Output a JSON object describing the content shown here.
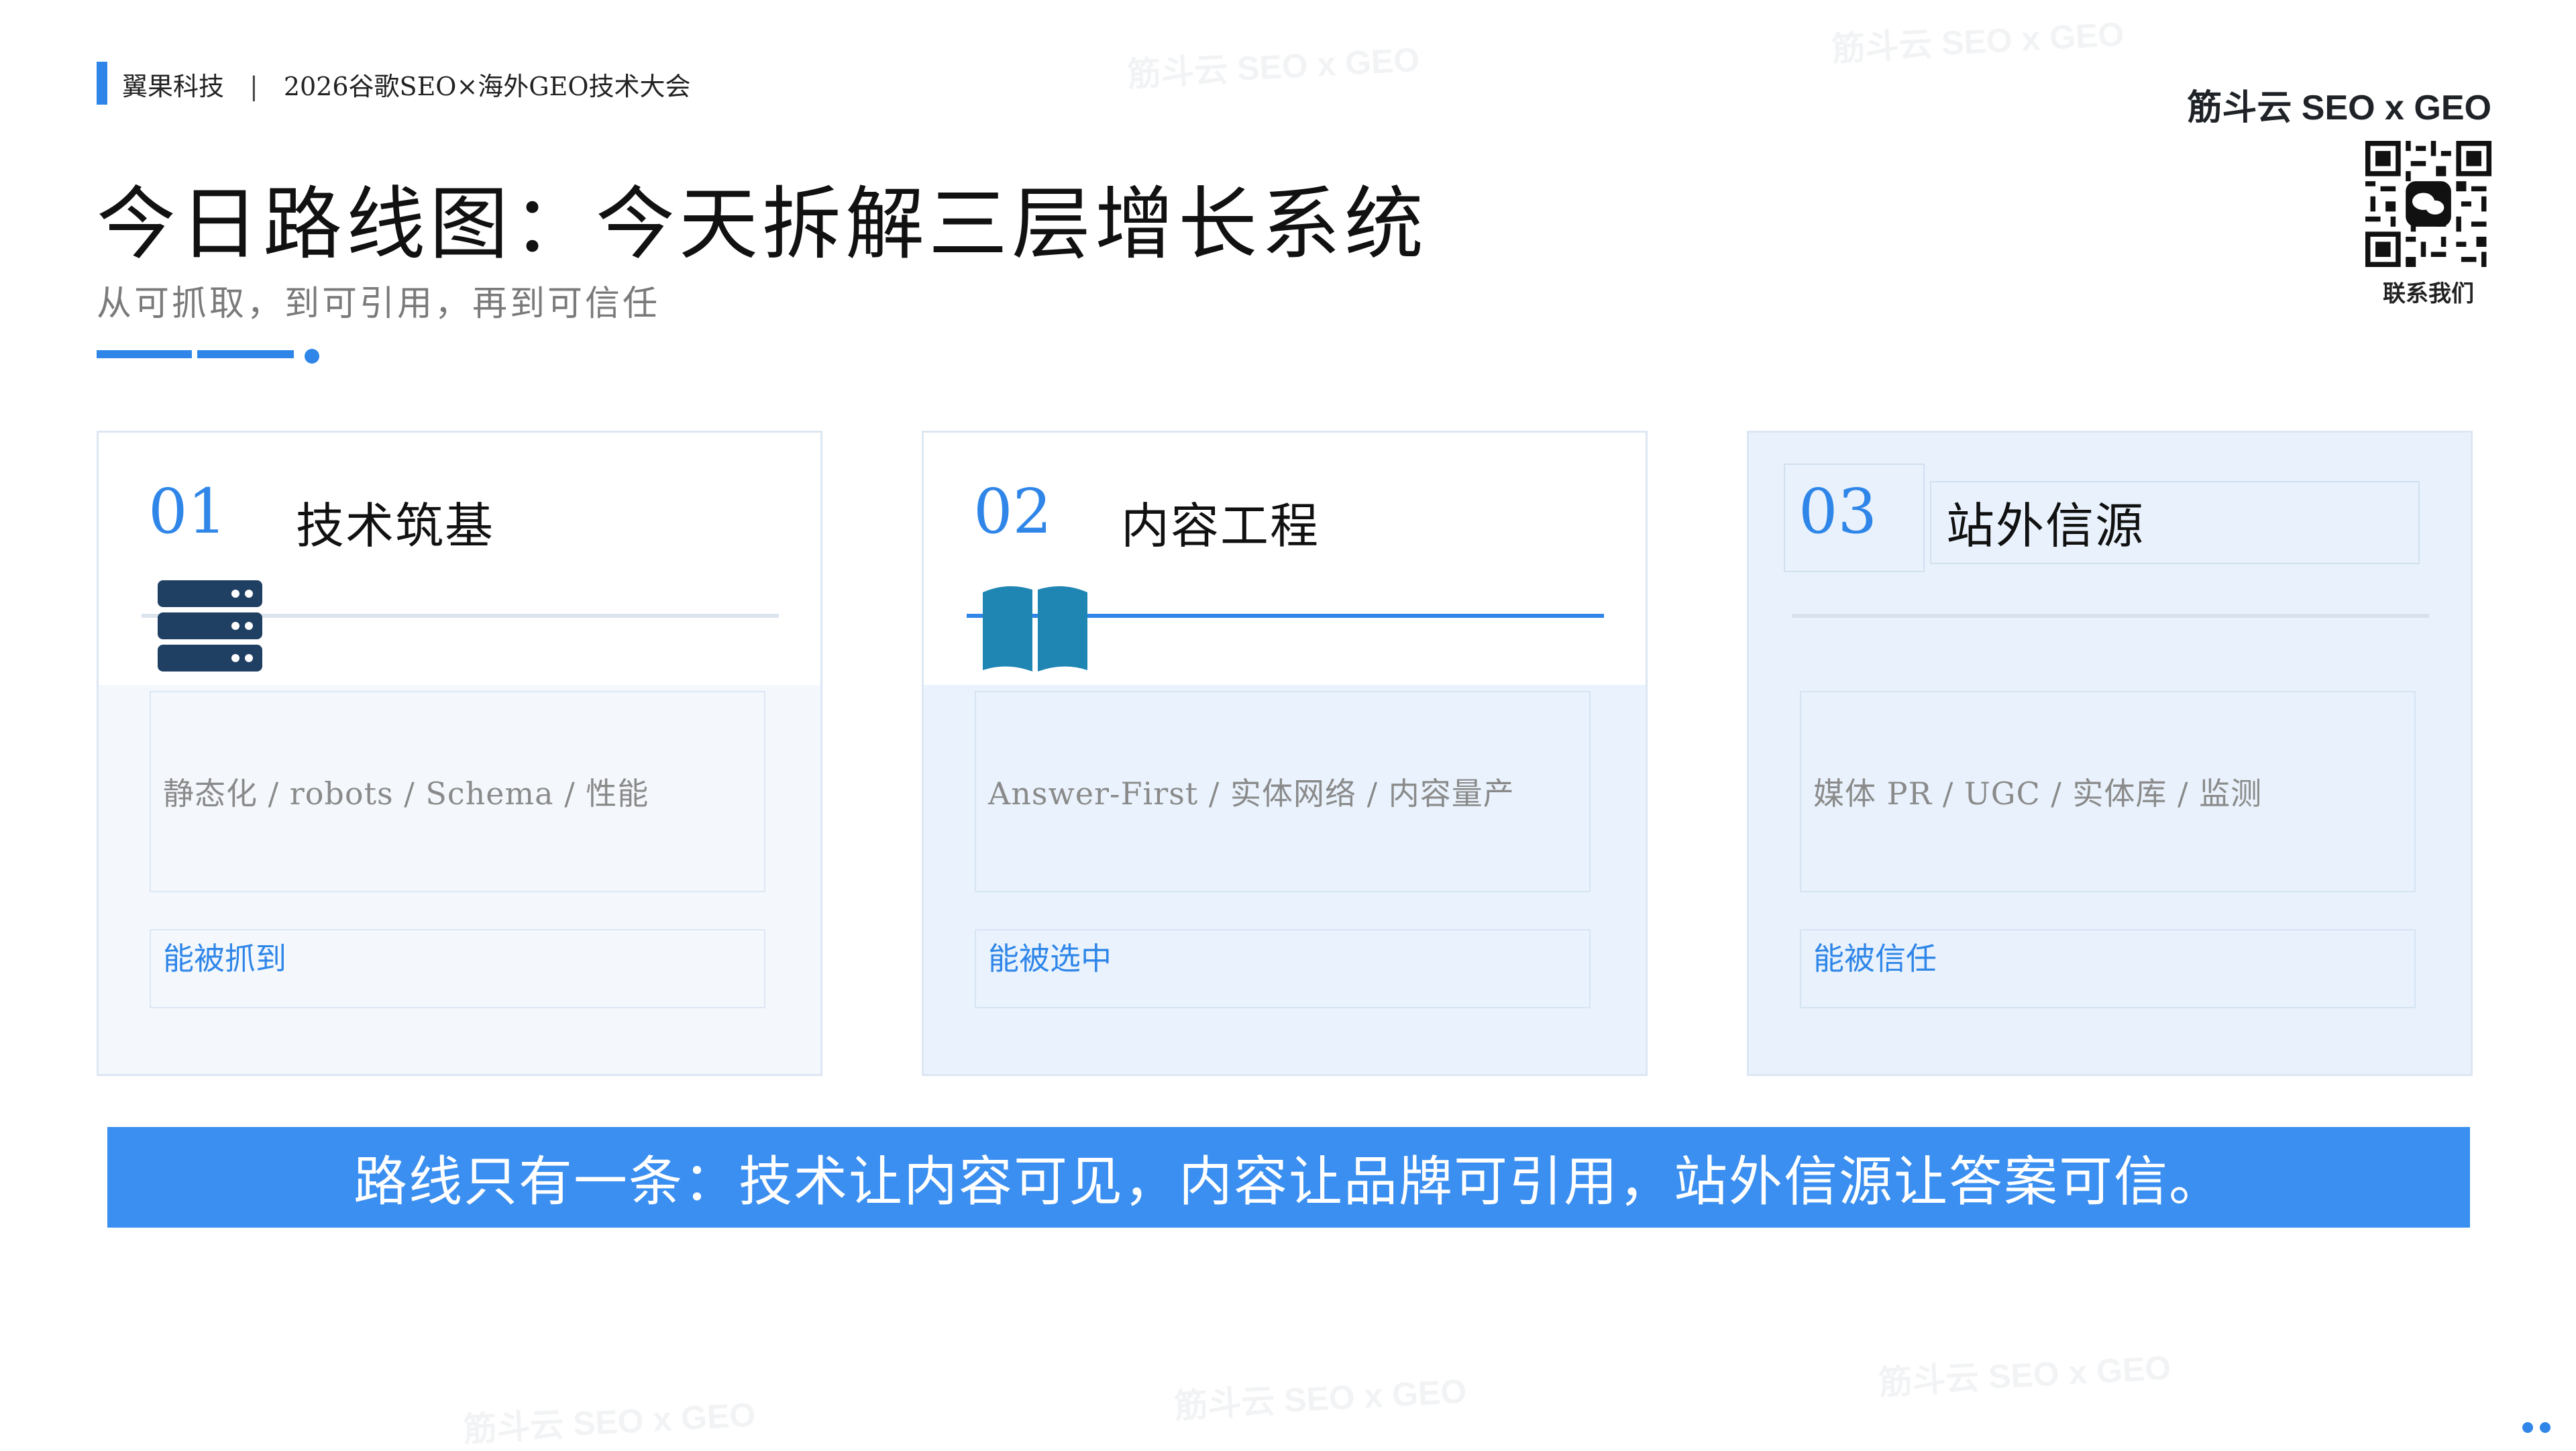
{
  "header": {
    "org": "翼果科技",
    "separator": "|",
    "event": "2026谷歌SEO×海外GEO技术大会"
  },
  "title": "今日路线图：今天拆解三层增长系统",
  "subtitle": "从可抓取，到可引用，再到可信任",
  "brand": {
    "name": "筋斗云 SEO x GEO",
    "contact_label": "联系我们"
  },
  "watermark_text": "筋斗云 SEO x GEO",
  "cards": [
    {
      "number": "01",
      "title": "技术筑基",
      "icon": "server-icon",
      "tags": "静态化 / robots / Schema / 性能",
      "goal": "能被抓到"
    },
    {
      "number": "02",
      "title": "内容工程",
      "icon": "book-icon",
      "tags": "Answer-First / 实体网络 / 内容量产",
      "goal": "能被选中"
    },
    {
      "number": "03",
      "title": "站外信源",
      "icon": "",
      "tags": "媒体 PR / UGC / 实体库 / 监测",
      "goal": "能被信任"
    }
  ],
  "banner": "路线只有一条：技术让内容可见，内容让品牌可引用，站外信源让答案可信。",
  "colors": {
    "accent": "#2f86e8",
    "banner_bg": "#3b8ff0",
    "server_icon": "#1f3f63",
    "book_icon": "#1f86b4"
  }
}
